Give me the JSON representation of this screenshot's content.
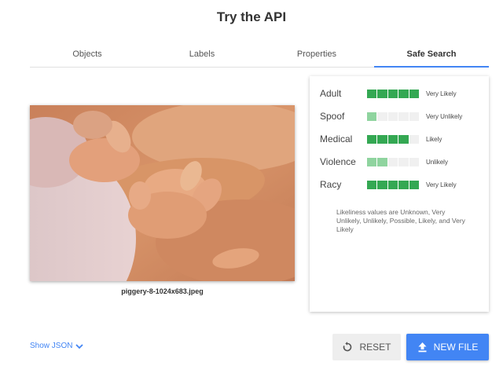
{
  "header": {
    "title": "Try the API"
  },
  "tabs": [
    {
      "label": "Objects",
      "active": false
    },
    {
      "label": "Labels",
      "active": false
    },
    {
      "label": "Properties",
      "active": false
    },
    {
      "label": "Safe Search",
      "active": true
    }
  ],
  "image": {
    "filename": "piggery-8-1024x683.jpeg"
  },
  "safe_search": {
    "rows": [
      {
        "label": "Adult",
        "value": "Very Likely",
        "level": 5
      },
      {
        "label": "Spoof",
        "value": "Very Unlikely",
        "level": 1
      },
      {
        "label": "Medical",
        "value": "Likely",
        "level": 4
      },
      {
        "label": "Violence",
        "value": "Unlikely",
        "level": 2
      },
      {
        "label": "Racy",
        "value": "Very Likely",
        "level": 5
      }
    ],
    "note": "Likeliness values are Unknown, Very Unlikely, Unlikely, Possible, Likely, and Very Likely"
  },
  "footer": {
    "show_json_label": "Show JSON",
    "reset_label": "RESET",
    "new_file_label": "NEW FILE"
  },
  "colors": {
    "accent": "#4285f4",
    "bar_on": "#34a853",
    "bar_partial": "#8fd49f",
    "bar_off": "#f0f0f0"
  },
  "icons": {
    "reset": "reset-icon",
    "upload": "upload-icon",
    "expand": "chevron-down-icon"
  }
}
